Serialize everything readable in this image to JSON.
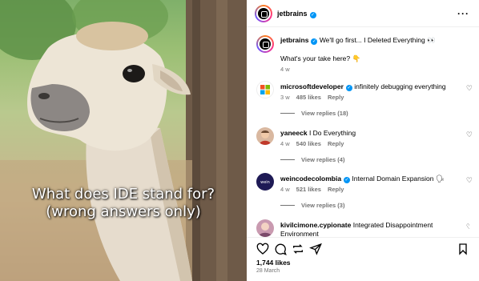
{
  "post": {
    "caption_line1": "What does IDE stand for?",
    "caption_line2": "(wrong answers only)"
  },
  "header": {
    "username": "jetbrains",
    "more_icon": "more-horizontal-icon"
  },
  "main_comment": {
    "username": "jetbrains",
    "text": "We'll go first... I Deleted Everything 👀",
    "text2": "What's your take here? 👇",
    "time": "4 w"
  },
  "comments": [
    {
      "username": "microsoftdeveloper",
      "text": "infinitely debugging everything",
      "time": "3 w",
      "likes": "485 likes",
      "reply": "Reply",
      "view_replies": "View replies (18)",
      "verified": true
    },
    {
      "username": "yaneeck",
      "text": "I Do Everything",
      "time": "4 w",
      "likes": "540 likes",
      "reply": "Reply",
      "view_replies": "View replies (4)",
      "verified": false
    },
    {
      "username": "weincodecolombia",
      "text": "Internal Domain Expansion 🗣",
      "time": "4 w",
      "likes": "521 likes",
      "reply": "Reply",
      "view_replies": "View replies (3)",
      "verified": true
    },
    {
      "username": "kivilcimone.cypionate",
      "text": "Integrated Disappointment Environment",
      "verified": false
    }
  ],
  "footer": {
    "likes": "1,744 likes",
    "date": "28 March"
  },
  "colors": {
    "verified": "#0095f6",
    "meta": "#737373",
    "jetbrains_gradient": [
      "#fc801d",
      "#ff318c",
      "#6b57ff"
    ]
  }
}
